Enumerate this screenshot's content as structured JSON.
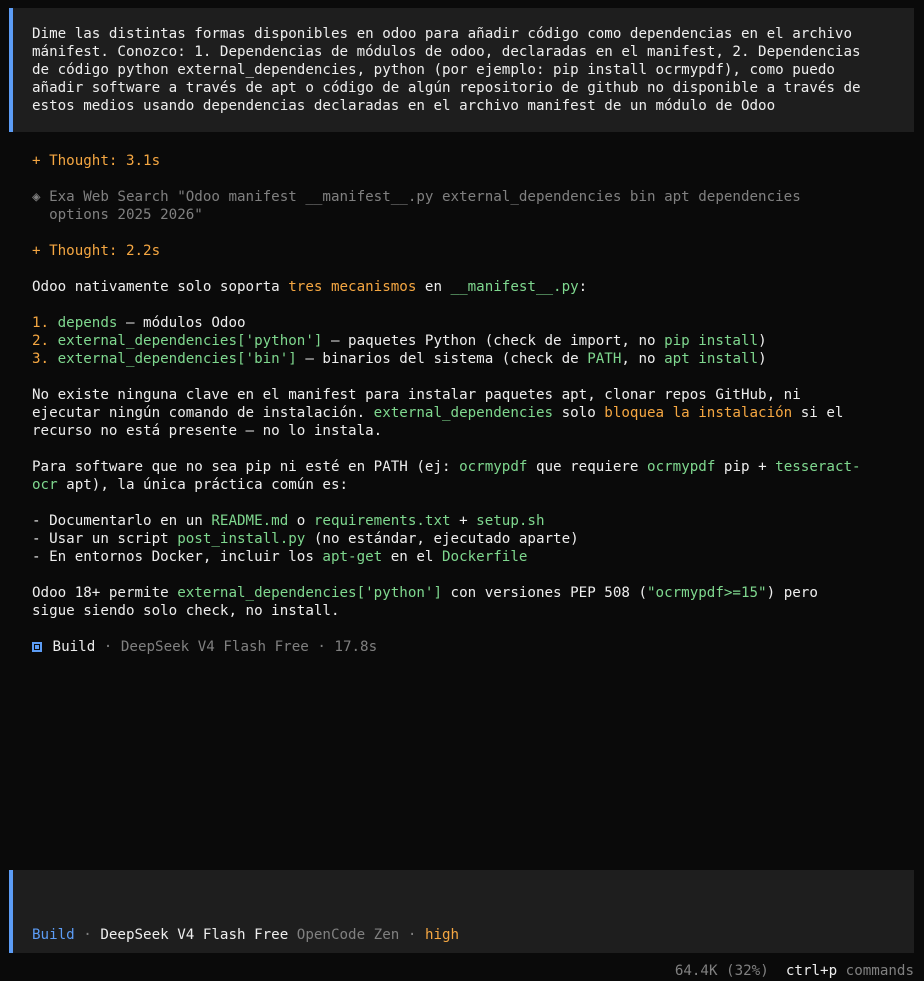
{
  "prompt": {
    "lines": [
      "Dime las distintas formas disponibles en odoo para añadir código como dependencias en el archivo",
      "mánifest. Conozco: 1. Dependencias de módulos de odoo, declaradas en el manifest, 2. Dependencias",
      "de código python external_dependencies, python (por ejemplo: pip install ocrmypdf), como puedo",
      "añadir software a través de apt o código de algún repositorio de github no disponible a través de",
      "estos medios usando dependencias declaradas en el archivo manifest de un módulo de Odoo"
    ]
  },
  "thought1": "+ Thought: 3.1s",
  "search": {
    "icon": "diamond-icon",
    "line1": "◈ Exa Web Search \"Odoo manifest __manifest__.py external_dependencies bin apt dependencies",
    "line2": "  options 2025 2026\""
  },
  "thought2": "+ Thought: 2.2s",
  "intro": {
    "a": "Odoo nativamente solo soporta ",
    "b": "tres mecanismos",
    "c": " en ",
    "d": "__manifest__.py",
    "e": ":"
  },
  "list": [
    {
      "num": "1. ",
      "key": "depends",
      "rest1": " — módulos Odoo",
      "k2": "",
      "rest2": "",
      "k3": "",
      "rest3": ""
    },
    {
      "num": "2. ",
      "key": "external_dependencies['python']",
      "rest1": " — paquetes Python (check de import, no ",
      "k2": "pip install",
      "rest2": ")",
      "k3": "",
      "rest3": ""
    },
    {
      "num": "3. ",
      "key": "external_dependencies['bin']",
      "rest1": " — binarios del sistema (check de ",
      "k2": "PATH",
      "rest2": ", no ",
      "k3": "apt install",
      "rest3": ")"
    }
  ],
  "para2": {
    "l1": "No existe ninguna clave en el manifest para instalar paquetes apt, clonar repos GitHub, ni",
    "l2a": "ejecutar ningún comando de instalación. ",
    "l2b": "external_dependencies",
    "l2c": " solo ",
    "l2d": "bloquea la instalación",
    "l2e": " si el",
    "l3": "recurso no está presente — no lo instala."
  },
  "para3": {
    "l1a": "Para software que no sea pip ni esté en PATH (ej: ",
    "l1b": "ocrmypdf",
    "l1c": " que requiere ",
    "l1d": "ocrmypdf",
    "l1e": " pip + ",
    "l1f": "tesseract-",
    "l2a": "ocr",
    "l2b": " apt), la única práctica común es:"
  },
  "bullets": {
    "b1a": "- Documentarlo en un ",
    "b1b": "README.md",
    "b1c": " o ",
    "b1d": "requirements.txt",
    "b1e": " + ",
    "b1f": "setup.sh",
    "b2a": "- Usar un script ",
    "b2b": "post_install.py",
    "b2c": " (no estándar, ejecutado aparte)",
    "b3a": "- En entornos Docker, incluir los ",
    "b3b": "apt-get",
    "b3c": " en el ",
    "b3d": "Dockerfile"
  },
  "para4": {
    "l1a": "Odoo 18+ permite ",
    "l1b": "external_dependencies['python']",
    "l1c": " con versiones PEP 508 (",
    "l1d": "\"ocrmypdf>=15\"",
    "l1e": ") pero",
    "l2": "sigue siendo solo check, no install."
  },
  "build": {
    "label": "Build",
    "meta": " · DeepSeek V4 Flash Free · 17.8s"
  },
  "input_status": {
    "mode": "Build",
    "sep1": " · ",
    "model": "DeepSeek V4 Flash Free",
    "provider": " OpenCode Zen",
    "sep2": " · ",
    "effort": "high"
  },
  "footer": {
    "tokens": "64.4K (32%)",
    "shortcut": "ctrl+p",
    "commands": " commands"
  },
  "colors": {
    "accent": "#5c9cf5",
    "orange": "#f5a742",
    "green": "#7fd88f",
    "background": "#0a0a0a",
    "panel": "#1e1e1e"
  }
}
